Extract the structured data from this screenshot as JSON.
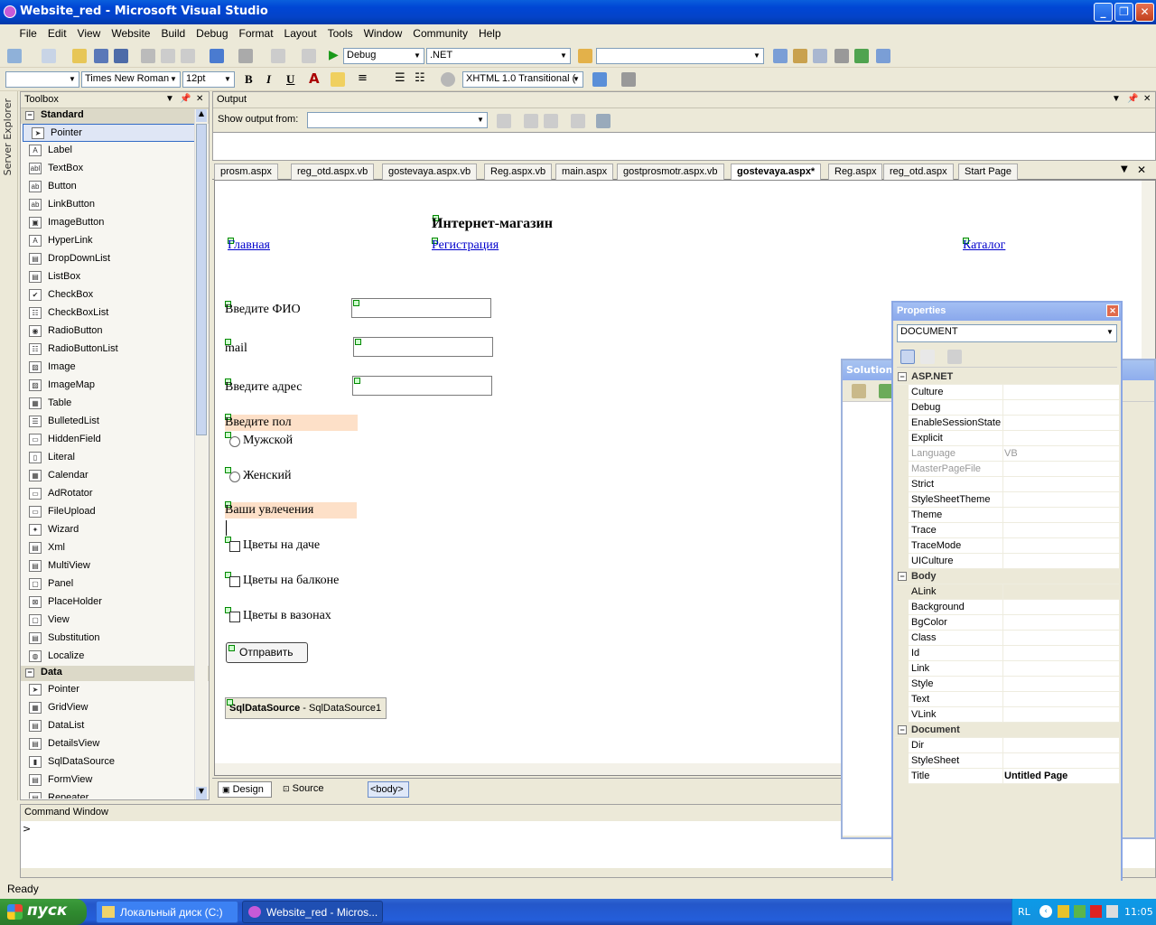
{
  "window": {
    "title": "Website_red - Microsoft Visual Studio"
  },
  "menu": [
    "File",
    "Edit",
    "View",
    "Website",
    "Build",
    "Debug",
    "Format",
    "Layout",
    "Tools",
    "Window",
    "Community",
    "Help"
  ],
  "toolbar": {
    "config": "Debug",
    "platform": ".NET",
    "font_family": "Times New Roman",
    "font_size": "12pt",
    "bold": "B",
    "italic": "I",
    "underline": "U",
    "doctype": "XHTML 1.0 Transitional ("
  },
  "toolbox": {
    "title": "Toolbox",
    "server_explorer": "Server Explorer",
    "sections": [
      {
        "name": "Standard",
        "items": [
          "Pointer",
          "Label",
          "TextBox",
          "Button",
          "LinkButton",
          "ImageButton",
          "HyperLink",
          "DropDownList",
          "ListBox",
          "CheckBox",
          "CheckBoxList",
          "RadioButton",
          "RadioButtonList",
          "Image",
          "ImageMap",
          "Table",
          "BulletedList",
          "HiddenField",
          "Literal",
          "Calendar",
          "AdRotator",
          "FileUpload",
          "Wizard",
          "Xml",
          "MultiView",
          "Panel",
          "PlaceHolder",
          "View",
          "Substitution",
          "Localize"
        ]
      },
      {
        "name": "Data",
        "items": [
          "Pointer",
          "GridView",
          "DataList",
          "DetailsView",
          "SqlDataSource",
          "FormView",
          "Repeater"
        ]
      }
    ]
  },
  "output": {
    "title": "Output",
    "show_from_label": "Show output from:"
  },
  "doc_tabs": [
    "prosm.aspx",
    "reg_otd.aspx.vb",
    "gostevaya.aspx.vb",
    "Reg.aspx.vb",
    "main.aspx",
    "gostprosmotr.aspx.vb",
    "gostevaya.aspx*",
    "Reg.aspx",
    "reg_otd.aspx",
    "Start Page"
  ],
  "active_tab": "gostevaya.aspx*",
  "page": {
    "heading": "Интернет-магазин",
    "links": [
      "Главная",
      "Регистрация",
      "Каталог"
    ],
    "fio_label": "Введите ФИО",
    "mail_label": "mail",
    "address_label": "Введите адрес",
    "gender_label": "Введите пол",
    "gender_options": [
      "Мужской",
      "Женский"
    ],
    "hobbies_label": "Ваши увлечения",
    "hobbies": [
      "Цветы на даче",
      "Цветы на балконе",
      "Цветы в вазонах"
    ],
    "submit": "Отправить",
    "datasource_type": "SqlDataSource",
    "datasource_name": " - SqlDataSource1"
  },
  "design_bar": {
    "design": "Design",
    "source": "Source",
    "tag": "<body>"
  },
  "command_window": {
    "title": "Command Window",
    "prompt": ">"
  },
  "status": "Ready",
  "solution_explorer": {
    "title": "Solution E"
  },
  "properties": {
    "title": "Properties",
    "object": "DOCUMENT",
    "categories": [
      {
        "name": "ASP.NET",
        "rows": [
          [
            "Culture",
            ""
          ],
          [
            "Debug",
            ""
          ],
          [
            "EnableSessionState",
            ""
          ],
          [
            "Explicit",
            ""
          ],
          [
            "Language",
            "VB"
          ],
          [
            "MasterPageFile",
            ""
          ],
          [
            "Strict",
            ""
          ],
          [
            "StyleSheetTheme",
            ""
          ],
          [
            "Theme",
            ""
          ],
          [
            "Trace",
            ""
          ],
          [
            "TraceMode",
            ""
          ],
          [
            "UICulture",
            ""
          ]
        ]
      },
      {
        "name": "Body",
        "rows": [
          [
            "ALink",
            ""
          ],
          [
            "Background",
            ""
          ],
          [
            "BgColor",
            ""
          ],
          [
            "Class",
            ""
          ],
          [
            "Id",
            ""
          ],
          [
            "Link",
            ""
          ],
          [
            "Style",
            ""
          ],
          [
            "Text",
            ""
          ],
          [
            "VLink",
            ""
          ]
        ]
      },
      {
        "name": "Document",
        "rows": [
          [
            "Dir",
            ""
          ],
          [
            "StyleSheet",
            ""
          ],
          [
            "Title",
            "Untitled Page"
          ]
        ]
      }
    ]
  },
  "taskbar": {
    "start": "пуск",
    "tasks": [
      "Локальный диск (C:)",
      "Website_red - Micros..."
    ],
    "lang": "RL",
    "clock": "11:05"
  }
}
